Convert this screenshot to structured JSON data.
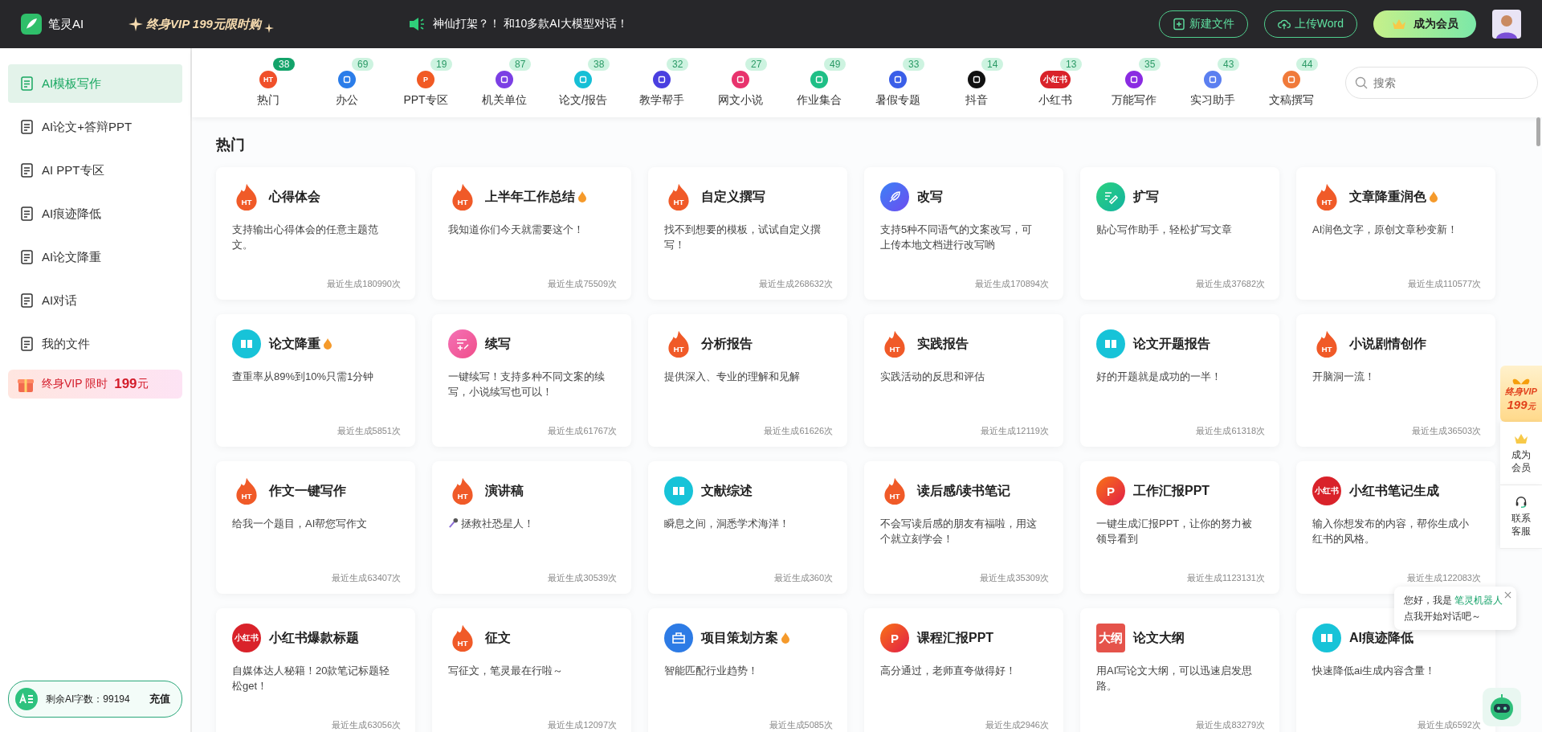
{
  "topbar": {
    "logo": "笔灵AI",
    "promo": "终身VIP 199元限时购",
    "announcement": "神仙打架？！ 和10多款AI大模型对话！",
    "buttons": [
      {
        "label": "新建文件",
        "kind": "new"
      },
      {
        "label": "上传Word",
        "kind": "upload"
      }
    ],
    "member_button": "成为会员"
  },
  "sidebar": {
    "items": [
      {
        "label": "AI模板写作",
        "selected": true
      },
      {
        "label": "AI论文+答辩PPT",
        "selected": false
      },
      {
        "label": "AI PPT专区",
        "selected": false
      },
      {
        "label": "AI痕迹降低",
        "selected": false
      },
      {
        "label": "AI论文降重",
        "selected": false
      },
      {
        "label": "AI对话",
        "selected": false
      },
      {
        "label": "我的文件",
        "selected": false
      }
    ],
    "vip_banner": {
      "label": "终身VIP 限时",
      "price": "199",
      "unit": "元"
    },
    "credits": {
      "label": "剩余AI字数：99194",
      "button": "充值"
    }
  },
  "categories": [
    {
      "label": "热门",
      "count": "38",
      "selected": true,
      "icon_text": "HT"
    },
    {
      "label": "办公",
      "count": "69",
      "selected": false
    },
    {
      "label": "PPT专区",
      "count": "19",
      "selected": false,
      "icon_text": "P"
    },
    {
      "label": "机关单位",
      "count": "87",
      "selected": false
    },
    {
      "label": "论文/报告",
      "count": "38",
      "selected": false
    },
    {
      "label": "教学帮手",
      "count": "32",
      "selected": false
    },
    {
      "label": "网文小说",
      "count": "27",
      "selected": false
    },
    {
      "label": "作业集合",
      "count": "49",
      "selected": false
    },
    {
      "label": "暑假专题",
      "count": "33",
      "selected": false
    },
    {
      "label": "抖音",
      "count": "14",
      "selected": false
    },
    {
      "label": "小红书",
      "count": "13",
      "selected": false,
      "icon_text": "小红书"
    },
    {
      "label": "万能写作",
      "count": "35",
      "selected": false
    },
    {
      "label": "实习助手",
      "count": "43",
      "selected": false
    },
    {
      "label": "文稿撰写",
      "count": "44",
      "selected": false
    }
  ],
  "search": {
    "placeholder": "搜索"
  },
  "section_title": "热门",
  "cards": [
    {
      "kind": "ht",
      "icon_text": "HT",
      "title": "心得体会",
      "hot": false,
      "desc": "支持输出心得体会的任意主题范文。",
      "count": "最近生成180990次"
    },
    {
      "kind": "ht",
      "icon_text": "HT",
      "title": "上半年工作总结",
      "hot": true,
      "desc": "我知道你们今天就需要这个！",
      "count": "最近生成75509次"
    },
    {
      "kind": "ht",
      "icon_text": "HT",
      "title": "自定义撰写",
      "hot": false,
      "desc": "找不到想要的模板，试试自定义撰写！",
      "count": "最近生成268632次"
    },
    {
      "kind": "feather",
      "title": "改写",
      "hot": false,
      "desc": "支持5种不同语气的文案改写，可上传本地文档进行改写哟",
      "count": "最近生成170894次"
    },
    {
      "kind": "pen",
      "title": "扩写",
      "hot": false,
      "desc": "贴心写作助手，轻松扩写文章",
      "count": "最近生成37682次"
    },
    {
      "kind": "ht",
      "icon_text": "HT",
      "title": "文章降重润色",
      "hot": true,
      "desc": "AI润色文字，原创文章秒变新！",
      "count": "最近生成110577次"
    },
    {
      "kind": "book",
      "title": "论文降重",
      "hot": true,
      "desc": "查重率从89%到10%只需1分钟",
      "count": "最近生成5851次"
    },
    {
      "kind": "list",
      "title": "续写",
      "hot": false,
      "desc": "一键续写！支持多种不同文案的续写，小说续写也可以！",
      "count": "最近生成61767次"
    },
    {
      "kind": "ht",
      "icon_text": "HT",
      "title": "分析报告",
      "hot": false,
      "desc": "提供深入、专业的理解和见解",
      "count": "最近生成61626次"
    },
    {
      "kind": "ht",
      "icon_text": "HT",
      "title": "实践报告",
      "hot": false,
      "desc": "实践活动的反思和评估",
      "count": "最近生成12119次"
    },
    {
      "kind": "book",
      "title": "论文开题报告",
      "hot": false,
      "desc": "好的开题就是成功的一半！",
      "count": "最近生成61318次"
    },
    {
      "kind": "ht",
      "icon_text": "HT",
      "title": "小说剧情创作",
      "hot": false,
      "desc": "开脑洞一流！",
      "count": "最近生成36503次"
    },
    {
      "kind": "ht",
      "icon_text": "HT",
      "title": "作文一键写作",
      "hot": false,
      "desc": "给我一个题目，AI帮您写作文",
      "count": "最近生成63407次"
    },
    {
      "kind": "ht",
      "icon_text": "HT",
      "title": "演讲稿",
      "hot": false,
      "mic": true,
      "desc": "拯救社恐星人！",
      "count": "最近生成30539次"
    },
    {
      "kind": "book",
      "title": "文献综述",
      "hot": false,
      "desc": "瞬息之间，洞悉学术海洋！",
      "count": "最近生成360次"
    },
    {
      "kind": "ht",
      "icon_text": "HT",
      "title": "读后感/读书笔记",
      "hot": false,
      "desc": "不会写读后感的朋友有福啦，用这个就立刻学会！",
      "count": "最近生成35309次"
    },
    {
      "kind": "ppt",
      "icon_text": "P",
      "title": "工作汇报PPT",
      "hot": false,
      "desc": "一键生成汇报PPT，让你的努力被领导看到",
      "count": "最近生成1123131次"
    },
    {
      "kind": "xhs",
      "icon_text": "小红书",
      "title": "小红书笔记生成",
      "hot": false,
      "desc": "输入你想发布的内容，帮你生成小红书的风格。",
      "count": "最近生成122083次"
    },
    {
      "kind": "xhs",
      "icon_text": "小红书",
      "title": "小红书爆款标题",
      "hot": false,
      "desc": "自媒体达人秘籍！20款笔记标题轻松get！",
      "count": "最近生成63056次"
    },
    {
      "kind": "ht",
      "icon_text": "HT",
      "title": "征文",
      "hot": false,
      "desc": "写征文，笔灵最在行啦～",
      "count": "最近生成12097次"
    },
    {
      "kind": "bag",
      "title": "项目策划方案",
      "hot": true,
      "desc": "智能匹配行业趋势！",
      "count": "最近生成5085次"
    },
    {
      "kind": "ppt",
      "icon_text": "P",
      "title": "课程汇报PPT",
      "hot": false,
      "desc": "高分通过，老师直夸做得好！",
      "count": "最近生成2946次"
    },
    {
      "kind": "outline",
      "icon_text": "大纲",
      "title": "论文大纲",
      "hot": false,
      "desc": "用AI写论文大纲，可以迅速启发思路。",
      "count": "最近生成83279次"
    },
    {
      "kind": "book",
      "title": "AI痕迹降低",
      "hot": false,
      "desc": "快速降低ai生成内容含量！",
      "count": "最近生成6592次"
    }
  ],
  "float_panel": {
    "vip_line1": "终身VIP",
    "vip_price": "199",
    "vip_unit": "元",
    "buttons": [
      {
        "kind": "member",
        "label": "成为会员"
      },
      {
        "kind": "service",
        "label": "联系客服"
      }
    ]
  },
  "chat_bubble": {
    "greeting": "您好，我是",
    "name": "笔灵机器人",
    "prompt": "点我开始对话吧～"
  }
}
